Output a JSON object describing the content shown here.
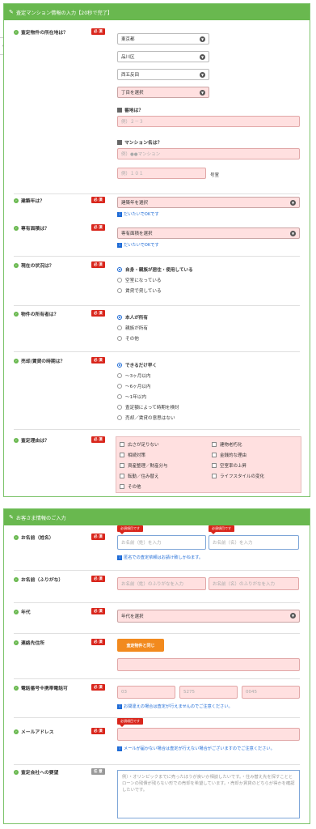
{
  "section1": {
    "title": "査定マンション情報の入力【20秒で完了】",
    "location": {
      "label": "査定物件の所在地は？",
      "required": "必 須",
      "prefecture": "東京都",
      "city": "品川区",
      "town": "西五反田",
      "chome_placeholder": "丁目を選択",
      "banchi_label": "番地は？",
      "banchi_placeholder": "例）２－３",
      "mansion_label": "マンション名は？",
      "mansion_placeholder": "例）●●マンション",
      "room_placeholder": "例）１０１",
      "room_unit": "号室"
    },
    "build_year": {
      "label": "建築年は？",
      "required": "必 須",
      "placeholder": "建築年を選択",
      "hint": "だいたいでOKです"
    },
    "area": {
      "label": "専有面積は？",
      "required": "必 須",
      "placeholder": "専有面積を選択",
      "hint": "だいたいでOKです"
    },
    "status": {
      "label": "現在の状況は？",
      "required": "必 須",
      "options": [
        "自身・親族が居住・使用している",
        "空室になっている",
        "賃貸で貸している"
      ]
    },
    "owner": {
      "label": "物件の所有者は？",
      "required": "必 須",
      "options": [
        "本人が所有",
        "親族が所有",
        "その他"
      ]
    },
    "timing": {
      "label": "売却/賃貸の時期は？",
      "required": "必 須",
      "options": [
        "できるだけ早く",
        "～3ヶ月以内",
        "～6ヶ月以内",
        "～1年以内",
        "査定額によって時期を検討",
        "売却／賃貸の意思はない"
      ]
    },
    "reason": {
      "label": "査定理由は？",
      "required": "必 須",
      "left": [
        "広さが足りない",
        "相続対策",
        "資産整理／財産分与",
        "転勤／住み替え",
        "その他"
      ],
      "right": [
        "建物老朽化",
        "金銭的な理由",
        "空室率の上昇",
        "ライフスタイルの変化"
      ]
    }
  },
  "section2": {
    "title": "お客さま情報のご入力",
    "name": {
      "label": "お名前（姓名）",
      "required": "必 須",
      "tip": "必須項目です",
      "last_placeholder": "お名前（姓）を入力",
      "first_placeholder": "お名前（名）を入力",
      "hint": "匿名での査定依頼はお請け致しかねます。"
    },
    "kana": {
      "label": "お名前（ふりがな）",
      "required": "必 須",
      "last_placeholder": "お名前（姓）のふりがなを入力",
      "first_placeholder": "お名前（名）のふりがなを入力"
    },
    "age": {
      "label": "年代",
      "required": "必 須",
      "placeholder": "年代を選択"
    },
    "address": {
      "label": "連絡先住所",
      "required": "必 須",
      "button": "査定物件と同じ"
    },
    "phone": {
      "label": "電話番号※携帯電話可",
      "required": "必 須",
      "p1": "03",
      "p2": "5275",
      "p3": "0045",
      "hint": "お間違えの場合は査定が行えませんのでご注意ください。"
    },
    "email": {
      "label": "メールアドレス",
      "required": "必 須",
      "tip": "必須項目です",
      "hint": "メールが届かない場合は査定が行えない場合がございますのでご注意ください。"
    },
    "request": {
      "label": "査定会社への要望",
      "optional": "任 意",
      "placeholder": "例）・オリンピックまでに売ったほうが良いか相談したいです。・住み替え先を探すこととローンの残債が残らない形での売却を希望しています。・売却か賃貸のどちらが得かを確認したいです。"
    }
  },
  "colors": {
    "accent": "#69b84f",
    "required": "#d9261c",
    "field": "#ffe0e0",
    "hint": "#1e6bd6",
    "button": "#f28a1e"
  }
}
